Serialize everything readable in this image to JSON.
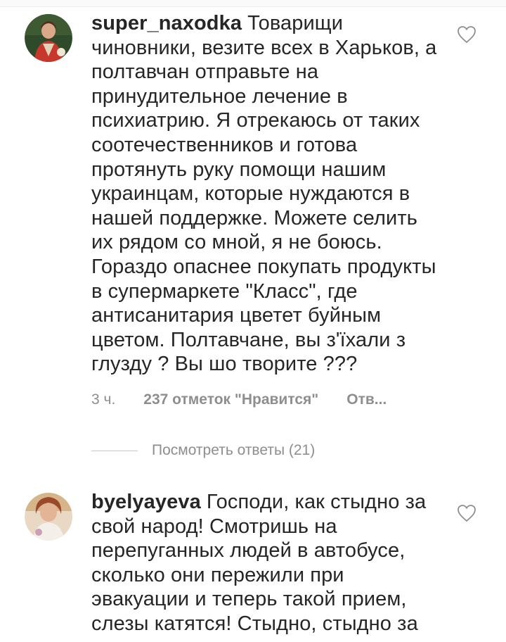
{
  "comments": [
    {
      "username": "super_naxodka",
      "text": "Товарищи чиновники, везите всех в Харьков, а полтавчан отправьте на принудительное лечение в психиатрию. Я отрекаюсь от таких соотечественников и готова протянуть руку помощи нашим украинцам, которые нуждаются в нашей поддержке. Можете селить их рядом со мной, я не боюсь. Гораздо опаснее покупать продукты в супермаркете \"Класс\", где антисанитария цветет буйным цветом. Полтавчане, вы з'їхали з глузду ? Вы шо творите ???",
      "time": "3 ч.",
      "likes": "237 отметок \"Нравится\"",
      "reply": "Отв...",
      "view_replies": "Посмотреть ответы (21)",
      "avatar_icon": "avatar-photo",
      "like_icon": "heart-outline-icon"
    },
    {
      "username": "byelyayeva",
      "text": "Господи, как стыдно за свой народ! Смотришь на перепуганных людей в автобусе, сколько они пережили при эвакуации и теперь такой прием, слезы катятся! Стыдно, стыдно за",
      "avatar_icon": "avatar-photo",
      "like_icon": "heart-outline-icon"
    }
  ],
  "colors": {
    "text": "#262626",
    "secondary": "#8e8e8e",
    "divider": "#c7c7c7"
  }
}
